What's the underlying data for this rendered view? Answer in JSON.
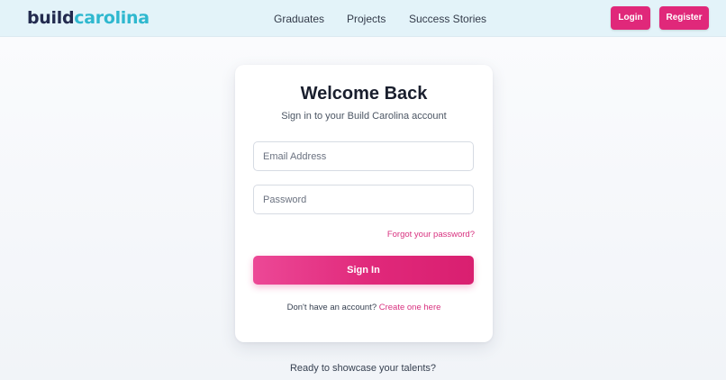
{
  "header": {
    "logo": {
      "part1": "build",
      "part2": "carolina"
    },
    "nav": [
      {
        "label": "Graduates"
      },
      {
        "label": "Projects"
      },
      {
        "label": "Success Stories"
      }
    ],
    "login_label": "Login",
    "register_label": "Register"
  },
  "login_card": {
    "title": "Welcome Back",
    "subtitle": "Sign in to your Build Carolina account",
    "email_placeholder": "Email Address",
    "password_placeholder": "Password",
    "forgot_label": "Forgot your password?",
    "signin_label": "Sign In",
    "no_account_text": "Don't have an account?",
    "create_link_label": "Create one here"
  },
  "footer": {
    "showcase_text": "Ready to showcase your talents?"
  },
  "colors": {
    "accent": "#e0287a",
    "logo_dark": "#232b4f",
    "logo_teal": "#2fb8cf",
    "header_bg": "#e3f3f9"
  }
}
